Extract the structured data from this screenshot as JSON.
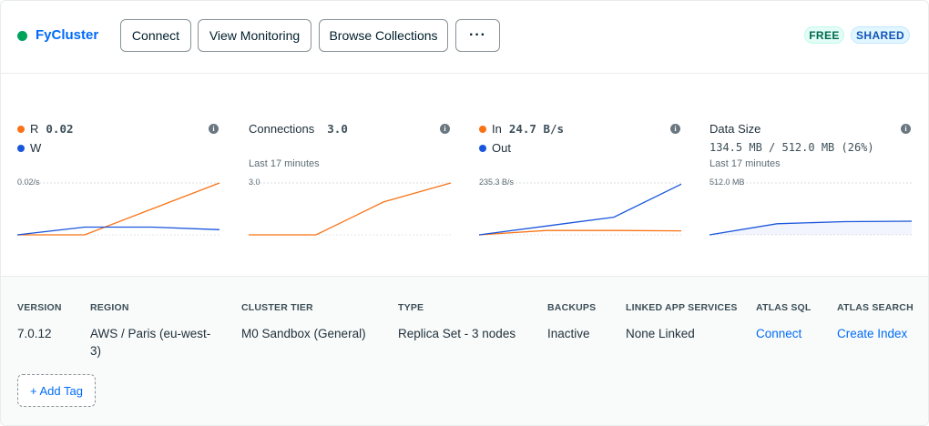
{
  "header": {
    "cluster_name": "FyCluster",
    "status_color": "#00a35c",
    "buttons": {
      "connect": "Connect",
      "view_monitoring": "View Monitoring",
      "browse_collections": "Browse Collections",
      "more": "···"
    },
    "badges": {
      "free": "FREE",
      "shared": "SHARED"
    }
  },
  "metrics": [
    {
      "primary_label": "R",
      "primary_value": "0.02",
      "secondary_label": "W",
      "secondary_value": "",
      "subtitle": "",
      "ymax_label": "0.02/s",
      "info_icon": "info-icon"
    },
    {
      "primary_label": "Connections",
      "primary_value": "3.0",
      "subtitle": "Last 17 minutes",
      "ymax_label": "3.0",
      "info_icon": "info-icon"
    },
    {
      "primary_label": "In",
      "primary_value": "24.7 B/s",
      "secondary_label": "Out",
      "subtitle": "",
      "ymax_label": "235.3 B/s",
      "info_icon": "info-icon"
    },
    {
      "primary_label": "Data Size",
      "value_line": "134.5 MB / 512.0 MB (26%)",
      "subtitle": "Last 17 minutes",
      "ymax_label": "512.0 MB",
      "info_icon": "info-icon"
    }
  ],
  "chart_data": [
    {
      "type": "line",
      "x": [
        0,
        1,
        2,
        3
      ],
      "ylim": [
        0,
        0.02
      ],
      "series": [
        {
          "name": "R",
          "color": "#f97316",
          "values": [
            0,
            0,
            0.01,
            0.02
          ]
        },
        {
          "name": "W",
          "color": "#1a56db",
          "values": [
            0,
            0.003,
            0.003,
            0.002
          ]
        }
      ]
    },
    {
      "type": "line",
      "x": [
        0,
        1,
        2,
        3
      ],
      "ylim": [
        0,
        3.0
      ],
      "series": [
        {
          "color": "#f97316",
          "values": [
            0,
            0,
            1.9,
            3.0
          ]
        }
      ]
    },
    {
      "type": "line",
      "x": [
        0,
        1,
        2,
        3
      ],
      "ylim": [
        0,
        235.3
      ],
      "series": [
        {
          "name": "In",
          "color": "#f97316",
          "values": [
            0,
            20,
            20,
            18
          ]
        },
        {
          "name": "Out",
          "color": "#1a56db",
          "values": [
            0,
            40,
            80,
            230
          ]
        }
      ]
    },
    {
      "type": "area",
      "x": [
        0,
        1,
        2,
        3
      ],
      "ylim": [
        0,
        512.0
      ],
      "series": [
        {
          "color": "#1a56db",
          "values": [
            0,
            110,
            130,
            134.5
          ]
        }
      ]
    }
  ],
  "details": {
    "columns": [
      {
        "head": "VERSION",
        "value": "7.0.12"
      },
      {
        "head": "REGION",
        "value": "AWS / Paris (eu-west-3)"
      },
      {
        "head": "CLUSTER TIER",
        "value": "M0 Sandbox (General)"
      },
      {
        "head": "TYPE",
        "value": "Replica Set - 3 nodes"
      },
      {
        "head": "BACKUPS",
        "value": "Inactive"
      },
      {
        "head": "LINKED APP SERVICES",
        "value": "None Linked"
      },
      {
        "head": "ATLAS SQL",
        "value": "Connect"
      },
      {
        "head": "ATLAS SEARCH",
        "value": "Create Index"
      }
    ],
    "add_tag": "+ Add Tag"
  }
}
